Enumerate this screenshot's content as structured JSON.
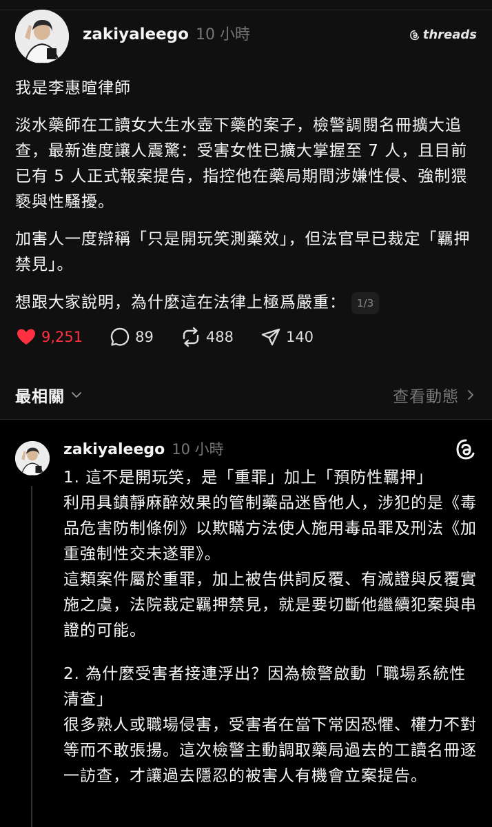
{
  "post": {
    "username": "zakiyaleego",
    "time": "10 小時",
    "brand": "threads",
    "paragraphs": [
      "我是李惠暄律師",
      "淡水藥師在工讀女大生水壺下藥的案子，檢警調閱名冊擴大追查，最新進度讓人震驚：受害女性已擴大掌握至 7 人，且目前已有 5 人正式報案提告，指控他在藥局期間涉嫌性侵、強制猥褻與性騷擾。",
      "加害人一度辯稱「只是開玩笑測藥效」，但法官早已裁定「羈押禁見」。",
      "想跟大家說明，為什麼這在法律上極爲嚴重："
    ],
    "pager": "1/3",
    "likes": "9,251",
    "comments": "89",
    "reposts": "488",
    "shares": "140"
  },
  "sort": {
    "label": "最相關",
    "activity": "查看動態"
  },
  "reply": {
    "username": "zakiyaleego",
    "time": "10 小時",
    "paragraphs": [
      "1. 這不是開玩笑，是「重罪」加上「預防性羈押」\n利用具鎮靜麻醉效果的管制藥品迷昏他人，涉犯的是《毒品危害防制條例》以欺瞞方法使人施用毒品罪及刑法《加重強制性交未遂罪》。\n這類案件屬於重罪，加上被告供詞反覆、有滅證與反覆實施之虞，法院裁定羈押禁見，就是要切斷他繼續犯案與串證的可能。",
      "2. 為什麼受害者接連浮出？因為檢警啟動「職場系統性清查」\n很多熟人或職場侵害，受害者在當下常因恐懼、權力不對等而不敢張揚。這次檢警主動調取藥局過去的工讀名冊逐一訪查，才讓過去隱忍的被害人有機會立案提告。"
    ]
  },
  "colors": {
    "background": "#000000",
    "card": "#101010",
    "like": "#ff3040",
    "muted": "#777777",
    "text": "#f3f5f7"
  },
  "icons": {
    "like": "heart-icon",
    "comment": "comment-icon",
    "repost": "repost-icon",
    "share": "send-icon",
    "threads": "threads-icon",
    "sort": "chevron-down-icon",
    "activity": "chevron-right-icon"
  }
}
